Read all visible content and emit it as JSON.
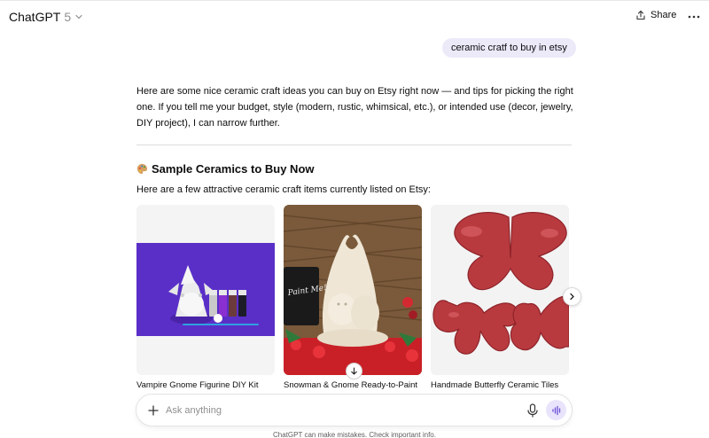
{
  "header": {
    "model_name": "ChatGPT",
    "model_version": "5",
    "share_label": "Share"
  },
  "conversation": {
    "user_message": "ceramic cratf to buy in etsy",
    "intro": "Here are some nice ceramic craft ideas you can buy on Etsy right now — and tips for picking the right one. If you tell me your budget, style (modern, rustic, whimsical, etc.), or intended use (decor, jewelry, DIY project), I can narrow further.",
    "section_title": "Sample Ceramics to Buy Now",
    "section_subtitle": "Here are a few attractive ceramic craft items currently listed on Etsy:",
    "products": [
      {
        "title": "Vampire Gnome Figurine DIY Kit"
      },
      {
        "title": "Snowman & Gnome Ready-to-Paint",
        "sign_text": "Paint Me!"
      },
      {
        "title": "Handmade Butterfly Ceramic Tiles"
      }
    ]
  },
  "composer": {
    "placeholder": "Ask anything"
  },
  "footer": {
    "disclaimer": "ChatGPT can make mistakes. Check important info."
  },
  "colors": {
    "user_bubble": "#ece9f9",
    "voice_button": "#e9e4fb",
    "product_1_background": "#5a2fc7",
    "product_3_glaze": "#b83a3f"
  },
  "icons": {
    "model_dropdown": "chevron-down-icon",
    "share": "share-icon",
    "more": "more-icon",
    "section": "palette-icon",
    "carousel_next": "chevron-right-icon",
    "scroll_down": "arrow-down-icon",
    "attach": "plus-icon",
    "dictate": "mic-icon",
    "voice_mode": "voice-icon"
  }
}
